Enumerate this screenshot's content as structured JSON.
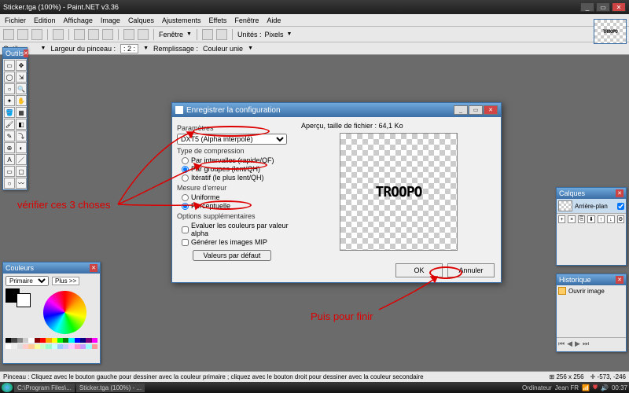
{
  "window": {
    "title": "Sticker.tga (100%) - Paint.NET v3.36"
  },
  "menu": [
    "Fichier",
    "Edition",
    "Affichage",
    "Image",
    "Calques",
    "Ajustements",
    "Effets",
    "Fenêtre",
    "Aide"
  ],
  "toolbar2": {
    "window_label": "Fenêtre",
    "units_label": "Unités :",
    "units_value": "Pixels"
  },
  "optbar": {
    "tool_label": "Outil :",
    "brush_label": "Largeur du pinceau :",
    "brush_value": "2",
    "fill_label": "Remplissage :",
    "fill_value": "Couleur unie"
  },
  "panels": {
    "tools_title": "Outils",
    "colors_title": "Couleurs",
    "colors_primary": "Primaire",
    "colors_plus": "Plus >>",
    "layers_title": "Calques",
    "layer_name": "Arrière-plan",
    "history_title": "Historique",
    "history_item": "Ouvrir image"
  },
  "dialog": {
    "title": "Enregistrer la configuration",
    "params_label": "Paramètres",
    "format_value": "DXT5 (Alpha interpolé)",
    "comp_label": "Type de compression",
    "comp_opts": [
      "Par intervalles (rapide/QF)",
      "Par groupes (lent/QH)",
      "Itératif (le plus lent/QH)"
    ],
    "err_label": "Mesure d'erreur",
    "err_opts": [
      "Uniforme",
      "Perceptuelle"
    ],
    "extra_label": "Options supplémentaires",
    "extra_opts": [
      "Evaluer les couleurs par valeur alpha",
      "Générer les images MIP"
    ],
    "defaults": "Valeurs par défaut",
    "preview_label": "Aperçu, taille de fichier : 64,1 Ko",
    "preview_text": "TROOPO",
    "ok": "OK",
    "cancel": "Annuler"
  },
  "annotations": {
    "left": "vérifier ces 3 choses",
    "right": "Puis pour finir"
  },
  "status": {
    "hint": "Pinceau : Cliquez avec le bouton gauche pour dessiner avec la couleur primaire ; cliquez avec le bouton droit pour dessiner avec la couleur secondaire",
    "size": "256 x 256",
    "coords": "-573, -246"
  },
  "taskbar": {
    "items": [
      "C:\\Program Files\\...",
      "Sticker.tga (100%) - ..."
    ],
    "info": "Ordinateur",
    "lang": "Jean    FR",
    "time": "00:37"
  },
  "thumb_text": "TROOPO"
}
